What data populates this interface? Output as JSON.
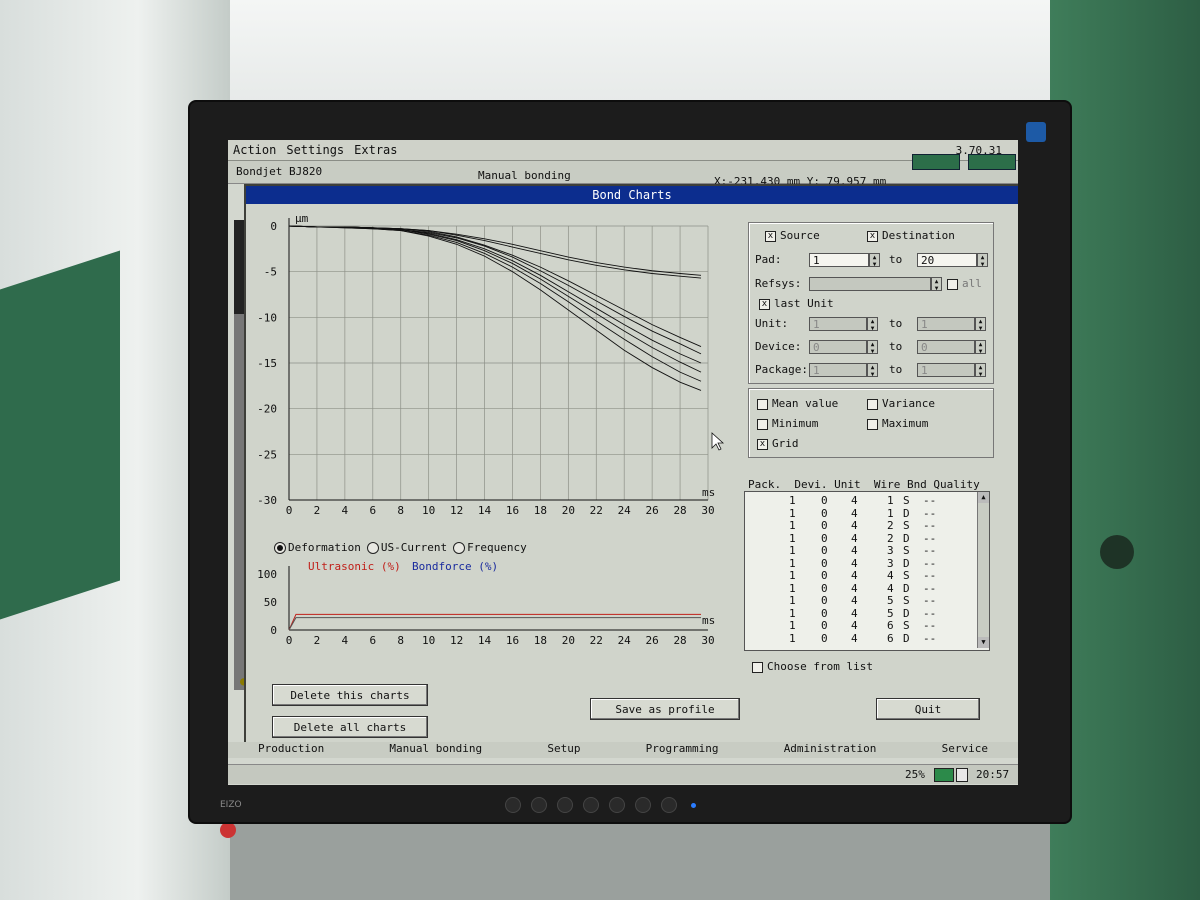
{
  "menu": [
    "Action",
    "Settings",
    "Extras"
  ],
  "version": "3.70.31",
  "status": {
    "machine": "Bondjet BJ820",
    "mode": "Manual bonding",
    "coords": "X:-231.430 mm  Y: 79.957 mm"
  },
  "dialog_title": "Bond Charts",
  "chart_data": [
    {
      "type": "line",
      "title": "",
      "xlabel": "ms",
      "ylabel": "µm",
      "xlim": [
        0,
        30
      ],
      "ylim": [
        -30,
        0
      ],
      "x_ticks": [
        "0",
        "2",
        "4",
        "6",
        "8",
        "10",
        "12",
        "14",
        "16",
        "18",
        "20",
        "22",
        "24",
        "26",
        "28",
        "30"
      ],
      "y_ticks": [
        "0",
        "-5",
        "-10",
        "-15",
        "-20",
        "-25",
        "-30"
      ],
      "grid": true,
      "x": [
        0,
        2,
        4,
        6,
        8,
        10,
        12,
        14,
        16,
        18,
        20,
        22,
        24,
        26,
        28,
        29.5
      ],
      "series": [
        {
          "values": [
            0,
            -0.1,
            -0.1,
            -0.2,
            -0.3,
            -0.6,
            -1.2,
            -2.1,
            -3.2,
            -4.5,
            -6.0,
            -7.6,
            -9.2,
            -10.8,
            -12.2,
            -13.2
          ]
        },
        {
          "values": [
            0,
            -0.1,
            -0.1,
            -0.2,
            -0.4,
            -0.8,
            -1.5,
            -2.5,
            -3.8,
            -5.4,
            -7.2,
            -9.0,
            -10.8,
            -12.5,
            -14.0,
            -15.0
          ]
        },
        {
          "values": [
            0,
            -0.1,
            -0.2,
            -0.3,
            -0.5,
            -1.0,
            -1.8,
            -3.0,
            -4.5,
            -6.3,
            -8.3,
            -10.4,
            -12.4,
            -14.3,
            -16.0,
            -17.0
          ]
        },
        {
          "values": [
            0,
            -0.1,
            -0.2,
            -0.3,
            -0.5,
            -1.1,
            -2.0,
            -3.3,
            -5.0,
            -7.0,
            -9.2,
            -11.4,
            -13.6,
            -15.5,
            -17.1,
            -18.0
          ]
        },
        {
          "values": [
            0,
            -0.1,
            -0.1,
            -0.2,
            -0.4,
            -0.7,
            -1.3,
            -2.2,
            -3.4,
            -4.9,
            -6.5,
            -8.2,
            -9.9,
            -11.5,
            -12.9,
            -14.0
          ]
        },
        {
          "values": [
            0,
            -0.1,
            -0.1,
            -0.2,
            -0.4,
            -0.9,
            -1.6,
            -2.7,
            -4.1,
            -5.8,
            -7.7,
            -9.6,
            -11.5,
            -13.3,
            -14.9,
            -16.0
          ]
        },
        {
          "values": [
            0,
            -0.1,
            -0.1,
            -0.2,
            -0.3,
            -0.5,
            -0.9,
            -1.4,
            -2.0,
            -2.7,
            -3.4,
            -4.0,
            -4.5,
            -4.9,
            -5.2,
            -5.4
          ]
        },
        {
          "values": [
            0,
            -0.1,
            -0.1,
            -0.2,
            -0.3,
            -0.5,
            -1.0,
            -1.6,
            -2.3,
            -3.0,
            -3.7,
            -4.3,
            -4.8,
            -5.2,
            -5.5,
            -5.7
          ]
        }
      ]
    },
    {
      "type": "line",
      "title": "",
      "xlabel": "ms",
      "ylabel": "",
      "xlim": [
        0,
        30
      ],
      "ylim": [
        0,
        100
      ],
      "x_ticks": [
        "0",
        "2",
        "4",
        "6",
        "8",
        "10",
        "12",
        "14",
        "16",
        "18",
        "20",
        "22",
        "24",
        "26",
        "28",
        "30"
      ],
      "y_ticks": [
        "100",
        "50",
        "0"
      ],
      "x": [
        0,
        0.5,
        29.5
      ],
      "series": [
        {
          "name": "Ultrasonic (%)",
          "color": "#c0201a",
          "values": [
            0,
            28,
            28
          ]
        },
        {
          "name": "Bondforce (%)",
          "color": "#555555",
          "values": [
            0,
            22,
            22
          ]
        }
      ]
    }
  ],
  "radios": [
    {
      "label": "Deformation",
      "checked": true
    },
    {
      "label": "US-Current",
      "checked": false
    },
    {
      "label": "Frequency",
      "checked": false
    }
  ],
  "legend": {
    "ultrasonic": "Ultrasonic (%)",
    "bondforce": "Bondforce (%)"
  },
  "filters": {
    "source": "Source",
    "destination": "Destination",
    "pad_label": "Pad:",
    "pad_from": "1",
    "pad_to": "20",
    "to": "to",
    "refsys_label": "Refsys:",
    "all": "all",
    "last_unit": "last Unit",
    "unit_label": "Unit:",
    "unit_from": "1",
    "unit_to": "1",
    "device_label": "Device:",
    "device_from": "0",
    "device_to": "0",
    "package_label": "Package:",
    "package_from": "1",
    "package_to": "1"
  },
  "stats": {
    "mean": "Mean value",
    "variance": "Variance",
    "minimum": "Minimum",
    "maximum": "Maximum",
    "grid": "Grid"
  },
  "list_header": "Pack.  Devi. Unit  Wire Bnd Quality",
  "list_rows": [
    [
      "1",
      "0",
      "4",
      "1",
      "S",
      "--"
    ],
    [
      "1",
      "0",
      "4",
      "1",
      "D",
      "--"
    ],
    [
      "1",
      "0",
      "4",
      "2",
      "S",
      "--"
    ],
    [
      "1",
      "0",
      "4",
      "2",
      "D",
      "--"
    ],
    [
      "1",
      "0",
      "4",
      "3",
      "S",
      "--"
    ],
    [
      "1",
      "0",
      "4",
      "3",
      "D",
      "--"
    ],
    [
      "1",
      "0",
      "4",
      "4",
      "S",
      "--"
    ],
    [
      "1",
      "0",
      "4",
      "4",
      "D",
      "--"
    ],
    [
      "1",
      "0",
      "4",
      "5",
      "S",
      "--"
    ],
    [
      "1",
      "0",
      "4",
      "5",
      "D",
      "--"
    ],
    [
      "1",
      "0",
      "4",
      "6",
      "S",
      "--"
    ],
    [
      "1",
      "0",
      "4",
      "6",
      "D",
      "--"
    ]
  ],
  "choose_from_list": "Choose from list",
  "buttons": {
    "delete_this": "Delete this charts",
    "delete_all": "Delete all charts",
    "save_profile": "Save as profile",
    "quit": "Quit"
  },
  "tabs": [
    "Production",
    "Manual bonding",
    "Setup",
    "Programming",
    "Administration",
    "Service"
  ],
  "taskbar": {
    "zoom": "25%",
    "clock": "20:57"
  },
  "monitor_brand": "EIZO"
}
